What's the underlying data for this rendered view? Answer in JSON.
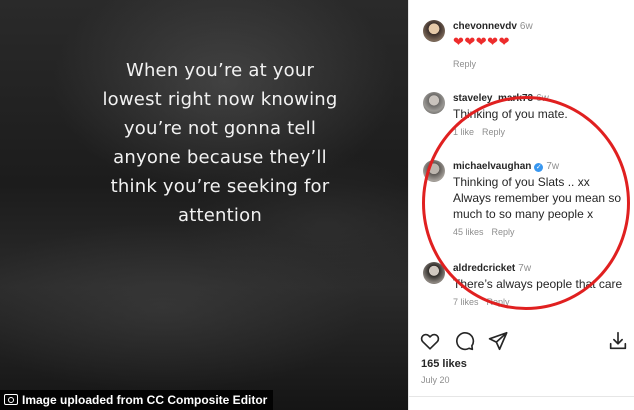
{
  "post": {
    "quote_lines": [
      "When you’re at your",
      "lowest right now knowing",
      "you’re not gonna tell",
      "anyone because they’ll",
      "think you’re seeking for",
      "attention"
    ],
    "credit": "Image uploaded from CC Composite Editor"
  },
  "comments": [
    {
      "username": "chevonnevdv",
      "time": "6w",
      "hearts": "❤❤❤❤❤",
      "likes": "",
      "reply": "Reply"
    },
    {
      "username": "staveley_mark73",
      "time": "6w",
      "text": "Thinking of you mate.",
      "likes": "1 like",
      "reply": "Reply"
    },
    {
      "username": "michaelvaughan",
      "time": "7w",
      "verified": true,
      "text_lines": [
        "Thinking of you Slats .. xx",
        "Always remember you mean so",
        "much to so many people x"
      ],
      "likes": "45 likes",
      "reply": "Reply"
    },
    {
      "username": "aldredcricket",
      "time": "7w",
      "text": "There’s always people that care",
      "likes": "7 likes",
      "reply": "Reply"
    }
  ],
  "footer": {
    "likes": "165 likes",
    "date": "July 20"
  },
  "icons": [
    "heart-icon",
    "comment-icon",
    "share-icon",
    "save-icon",
    "verified-icon",
    "camera-icon"
  ],
  "colors": {
    "annotation": "#e02020",
    "verified": "#3897f0",
    "hearts": "#ed2c2c"
  }
}
